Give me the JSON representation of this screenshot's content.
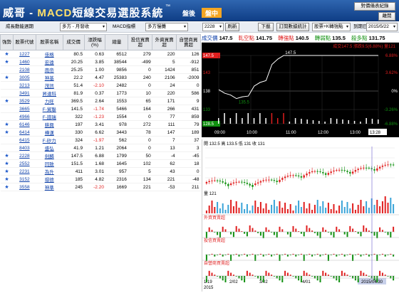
{
  "header": {
    "logo_a": "威哥 - ",
    "logo_b": "MACD",
    "logo_c": "短線交易選股系統",
    "tm": "™",
    "tab_after": "盤後",
    "tab_live": "盤中",
    "btn_news": "對價儀表紀錄",
    "btn_exit": "離開"
  },
  "toolbar": {
    "label_sector": "成長動能週期",
    "sel_type": "多方 - 月發收",
    "label_macd": "MACD指標",
    "sel_mode": "多方慢攤",
    "stock_input": "2228",
    "sel_arrow": "▼",
    "btn_load": "刷新",
    "btn_down": "下載",
    "btn_order": "訂閱數據統計",
    "sel_stock": "股票+K轉強點",
    "date_label": "到期日",
    "date_value": "2015/5/22"
  },
  "table": {
    "headers": [
      "強勢",
      "股票代號",
      "股票名稱",
      "成交價",
      "漲跌幅(%)",
      "總量",
      "投信買賣超",
      "外資買賣超",
      "自營商買賣超"
    ],
    "rows": [
      {
        "star": "★",
        "code": "1227",
        "name": "佳格",
        "price": "80.5",
        "chg": "0.63",
        "vol": "6512",
        "it": "279",
        "fi": "220",
        "dl": "126"
      },
      {
        "star": "★",
        "code": "1460",
        "name": "宏遠",
        "price": "20.25",
        "chg": "3.85",
        "vol": "38544",
        "it": "-499",
        "fi": "5",
        "dl": "-912"
      },
      {
        "star": "",
        "code": "2108",
        "name": "南帝",
        "price": "25.25",
        "chg": "1.00",
        "vol": "9856",
        "it": "0",
        "fi": "1424",
        "dl": "851"
      },
      {
        "star": "★",
        "code": "3005",
        "name": "神基",
        "price": "22.2",
        "chg": "4.47",
        "vol": "25383",
        "it": "240",
        "fi": "2106",
        "dl": "-2009"
      },
      {
        "star": "",
        "code": "3213",
        "name": "茂訊",
        "price": "51.4",
        "chg": "-2.10",
        "vol": "2482",
        "it": "0",
        "fi": "24",
        "dl": "0"
      },
      {
        "star": "",
        "code": "3491",
        "name": "昇達科",
        "price": "81.9",
        "chg": "0.37",
        "vol": "1773",
        "it": "10",
        "fi": "220",
        "dl": "586"
      },
      {
        "star": "★",
        "code": "3529",
        "name": "力旺",
        "price": "369.5",
        "chg": "2.64",
        "vol": "1553",
        "it": "65",
        "fi": "171",
        "dl": "9"
      },
      {
        "star": "",
        "code": "3665",
        "name": "F-貿聯",
        "price": "141.5",
        "chg": "-1.74",
        "vol": "5466",
        "it": "164",
        "fi": "266",
        "dl": "431"
      },
      {
        "star": "",
        "code": "4966",
        "name": "F-譜瑞",
        "price": "322",
        "chg": "-1.23",
        "vol": "1554",
        "it": "0",
        "fi": "77",
        "dl": "859"
      },
      {
        "star": "★",
        "code": "6146",
        "name": "耕興",
        "price": "197",
        "chg": "3.41",
        "vol": "978",
        "it": "272",
        "fi": "111",
        "dl": "79"
      },
      {
        "star": "★",
        "code": "6414",
        "name": "樺漢",
        "price": "330",
        "chg": "6.62",
        "vol": "3443",
        "it": "78",
        "fi": "147",
        "dl": "189"
      },
      {
        "star": "",
        "code": "6415",
        "name": "F-矽力",
        "price": "324",
        "chg": "-1.97",
        "vol": "562",
        "it": "0",
        "fi": "7",
        "dl": "37"
      },
      {
        "star": "",
        "code": "8403",
        "name": "盛弘",
        "price": "41.9",
        "chg": "1.21",
        "vol": "2064",
        "it": "0",
        "fi": "13",
        "dl": "3"
      },
      {
        "star": "★",
        "code": "2228",
        "name": "劍麟",
        "price": "147.5",
        "chg": "6.88",
        "vol": "1799",
        "it": "50",
        "fi": "-4",
        "dl": "-45"
      },
      {
        "star": "★",
        "code": "2552",
        "name": "同致",
        "price": "151.5",
        "chg": "1.68",
        "vol": "1645",
        "it": "102",
        "fi": "62",
        "dl": "18"
      },
      {
        "star": "★",
        "code": "2231",
        "name": "為升",
        "price": "411",
        "chg": "3.01",
        "vol": "957",
        "it": "5",
        "fi": "43",
        "dl": "0"
      },
      {
        "star": "★",
        "code": "3152",
        "name": "璟德",
        "price": "185",
        "chg": "4.82",
        "vol": "2316",
        "it": "134",
        "fi": "221",
        "dl": "-48"
      },
      {
        "star": "★",
        "code": "3558",
        "name": "神準",
        "price": "245",
        "chg": "-2.20",
        "vol": "1669",
        "it": "221",
        "fi": "-53",
        "dl": "211"
      }
    ]
  },
  "quote": {
    "l1": "成交價",
    "v1": "147.5",
    "l2": "軋空點",
    "v2": "141.75",
    "l3": "轉強點",
    "v3": "140.5",
    "l4": "轉弱點",
    "v4": "135.5",
    "l5": "殺多點",
    "v5": "131.75",
    "line2": "成交147.5 漲跌9.5(6.88%) 量121"
  },
  "intraday": {
    "y_left": [
      "147.5",
      "143",
      "138",
      "133",
      "128.5"
    ],
    "y_right": [
      "6.88%",
      "3.62%",
      "0%",
      "-3.26%",
      "-6.88%"
    ],
    "x": [
      "09:00",
      "10:00",
      "11:00",
      "12:00",
      "13:00",
      "13:28"
    ],
    "peak": "147.5",
    "low": "135.5",
    "chart_data": {
      "type": "line",
      "x": [
        "09:00",
        "09:10",
        "09:20",
        "09:30",
        "09:40",
        "09:50",
        "10:00",
        "10:10",
        "10:20",
        "10:30",
        "10:40",
        "10:50",
        "11:00",
        "11:10",
        "11:20",
        "11:30",
        "11:40",
        "11:50",
        "12:00",
        "12:10",
        "12:20",
        "12:30",
        "12:40",
        "12:50",
        "13:00",
        "13:10",
        "13:20",
        "13:28"
      ],
      "values": [
        138,
        137,
        136.5,
        135.5,
        136,
        136.2,
        139,
        140,
        140.5,
        145,
        146.5,
        147.5,
        147.5,
        147.5,
        147.5,
        147.5,
        147.5,
        147.5,
        147.5,
        147.5,
        147.5,
        147.5,
        147.5,
        147.5,
        147.5,
        147.5,
        147.5,
        147.5
      ],
      "ylim": [
        128.5,
        147.5
      ],
      "color": "#ffffff"
    }
  },
  "daily": {
    "info": "開 132.5 高 133.5 低 131 收 131",
    "vol_label": "量 121",
    "it_label": "外資買賣超",
    "fi_label": "投信買賣超",
    "dl_label": "自營商買賣超",
    "x": [
      "1/19\n2015",
      "2/02",
      "3/02",
      "4/01",
      "2015/04/30"
    ],
    "x1": "1/19",
    "x1b": "2015",
    "x2": "2/02",
    "x3": "3/02",
    "x4": "4/01",
    "x5": "2015/04/30",
    "colors": {
      "up": "#e01e1e",
      "down": "#109010"
    }
  }
}
